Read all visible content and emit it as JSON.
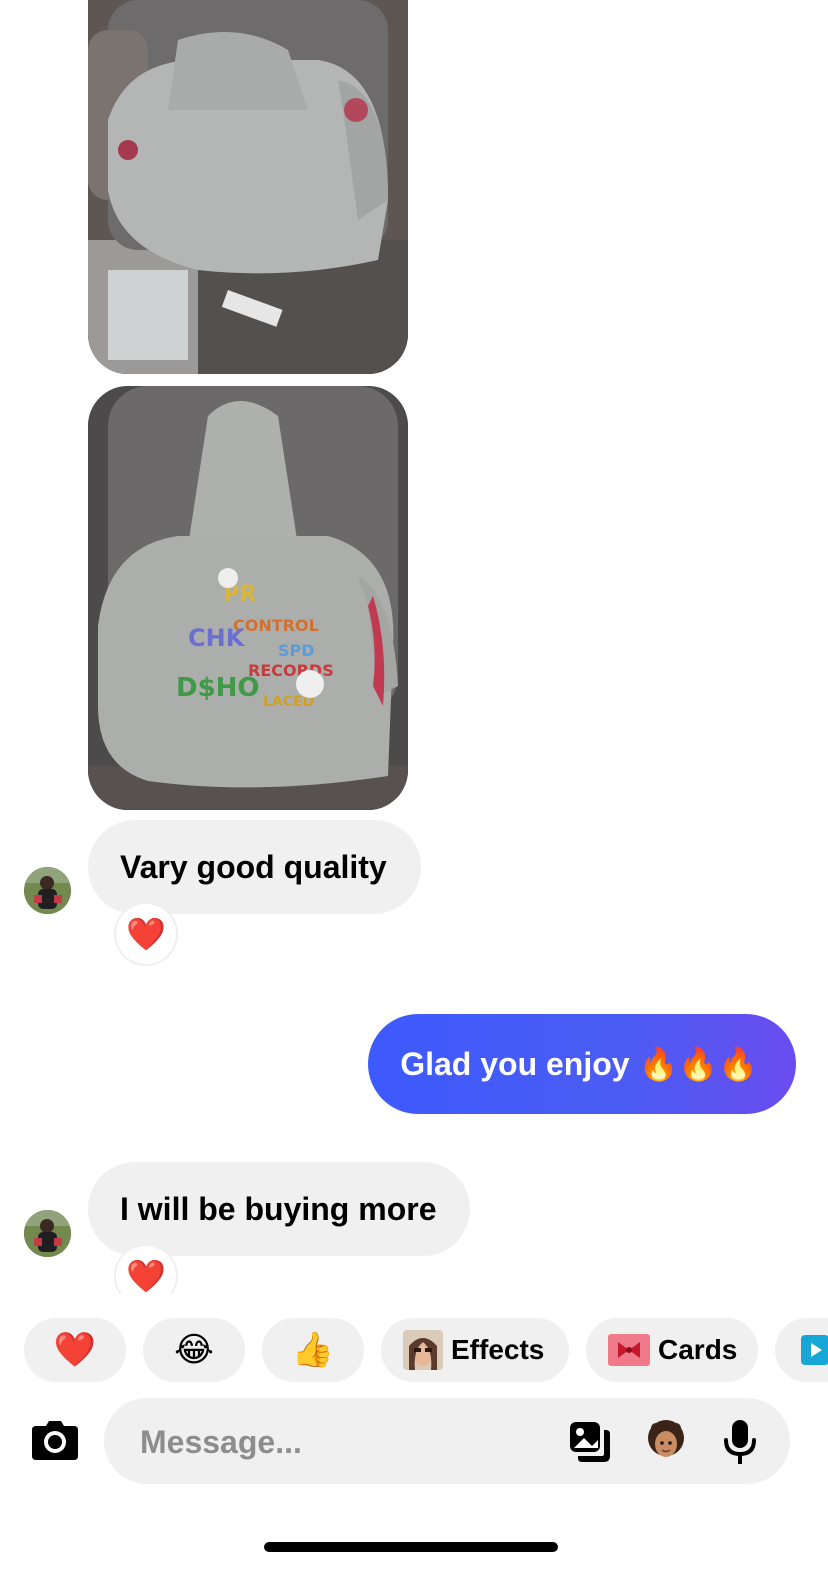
{
  "conversation": {
    "messages": [
      {
        "direction": "incoming",
        "text": "Vary good quality",
        "reaction": "❤️"
      },
      {
        "direction": "outgoing",
        "text": "Glad you enjoy 🔥🔥🔥"
      },
      {
        "direction": "incoming",
        "text": "I will be buying more",
        "reaction": "❤️"
      }
    ]
  },
  "quick_actions": {
    "heart": "❤️",
    "laugh": "😂",
    "thumbs_up": "👍",
    "effects_label": "Effects",
    "cards_label": "Cards"
  },
  "composer": {
    "placeholder": "Message..."
  },
  "icons": {
    "camera": "camera-icon",
    "gallery": "gallery-icon",
    "avatar_sticker": "avatar-sticker-icon",
    "microphone": "microphone-icon"
  },
  "colors": {
    "outgoing_bubble_start": "#3d5afe",
    "outgoing_bubble_end": "#6a4cf0",
    "incoming_bubble": "#f0f0f0",
    "reaction_heart": "#ee1d3a"
  }
}
